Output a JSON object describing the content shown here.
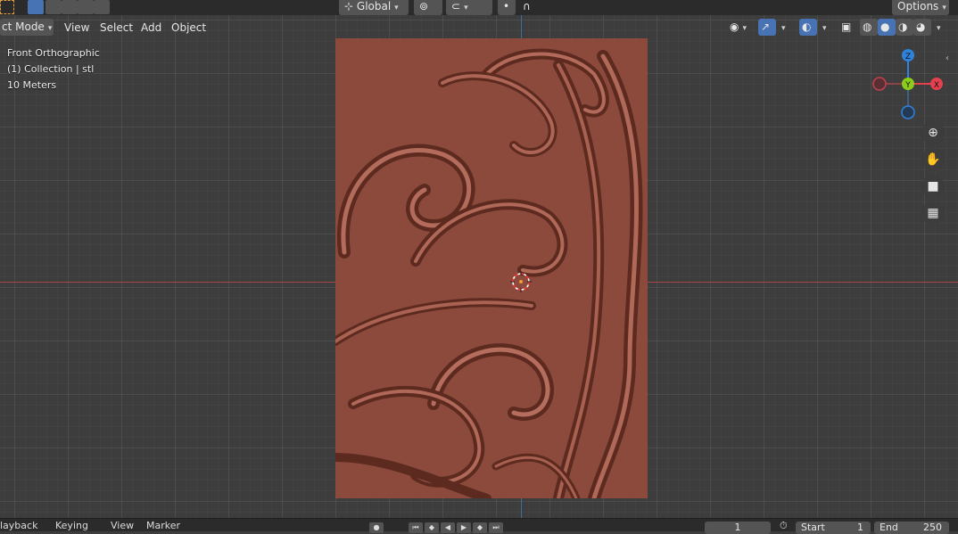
{
  "header": {
    "mode_label": "ct Mode",
    "menus": [
      "View",
      "Select",
      "Add",
      "Object"
    ],
    "transform_orientation": "Global",
    "options_label": "Options"
  },
  "viewport": {
    "view_name": "Front Orthographic",
    "collection_info": "(1) Collection | stl",
    "scale_info": "10 Meters"
  },
  "gizmo": {
    "z_label": "Z",
    "y_label": "Y",
    "x_label": "X",
    "colors": {
      "x": "#e2414d",
      "y": "#8ccc1a",
      "z": "#2f83db"
    }
  },
  "nav_icons": [
    "zoom-icon",
    "hand-pan-icon",
    "camera-icon",
    "grid-icon"
  ],
  "timeline": {
    "playback_label": "layback",
    "keying_label": "Keying",
    "view_label": "View",
    "marker_label": "Marker",
    "current_frame": "1",
    "start_label": "Start",
    "start_value": "1",
    "end_label": "End",
    "end_value": "250"
  },
  "colors": {
    "relief": "#8c4a3c",
    "x_axis": "#a8444b",
    "z_axis": "#3f6d9c",
    "selected": "#4772b3"
  }
}
